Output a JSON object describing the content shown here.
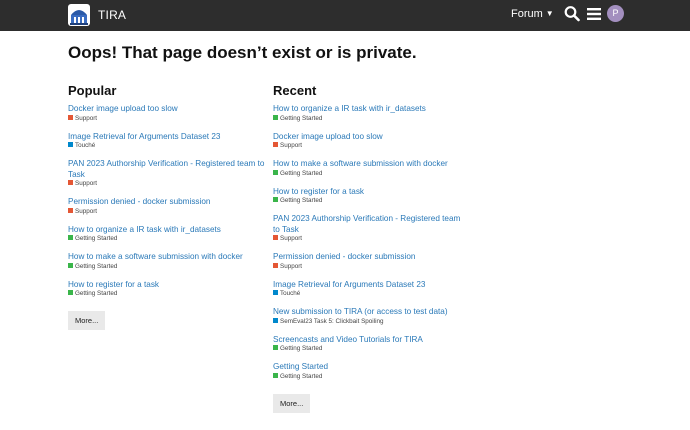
{
  "header": {
    "site_title": "TIRA",
    "forum_label": "Forum",
    "avatar_letter": "P"
  },
  "page_title": "Oops! That page doesn’t exist or is private.",
  "categories": {
    "Support": "#e45735",
    "Touché": "#0088cc",
    "Getting Started": "#3ab54a",
    "SemEval23 Task 5: Clickbait Spoiling": "#0088cc"
  },
  "popular": {
    "heading": "Popular",
    "more_label": "More...",
    "topics": [
      {
        "title": "Docker image upload too slow",
        "category": "Support"
      },
      {
        "title": "Image Retrieval for Arguments Dataset 23",
        "category": "Touché"
      },
      {
        "title": "PAN 2023 Authorship Verification - Registered team to Task",
        "category": "Support"
      },
      {
        "title": "Permission denied - docker submission",
        "category": "Support"
      },
      {
        "title": "How to organize a IR task with ir_datasets",
        "category": "Getting Started"
      },
      {
        "title": "How to make a software submission with docker",
        "category": "Getting Started"
      },
      {
        "title": "How to register for a task",
        "category": "Getting Started"
      }
    ]
  },
  "recent": {
    "heading": "Recent",
    "more_label": "More...",
    "topics": [
      {
        "title": "How to organize a IR task with ir_datasets",
        "category": "Getting Started"
      },
      {
        "title": "Docker image upload too slow",
        "category": "Support"
      },
      {
        "title": "How to make a software submission with docker",
        "category": "Getting Started"
      },
      {
        "title": "How to register for a task",
        "category": "Getting Started"
      },
      {
        "title": "PAN 2023 Authorship Verification - Registered team to Task",
        "category": "Support"
      },
      {
        "title": "Permission denied - docker submission",
        "category": "Support"
      },
      {
        "title": "Image Retrieval for Arguments Dataset 23",
        "category": "Touché"
      },
      {
        "title": "New submission to TIRA (or access to test data)",
        "category": "SemEval23 Task 5: Clickbait Spoiling"
      },
      {
        "title": "Screencasts and Video Tutorials for TIRA",
        "category": "Getting Started"
      },
      {
        "title": "Getting Started",
        "category": "Getting Started"
      }
    ]
  }
}
